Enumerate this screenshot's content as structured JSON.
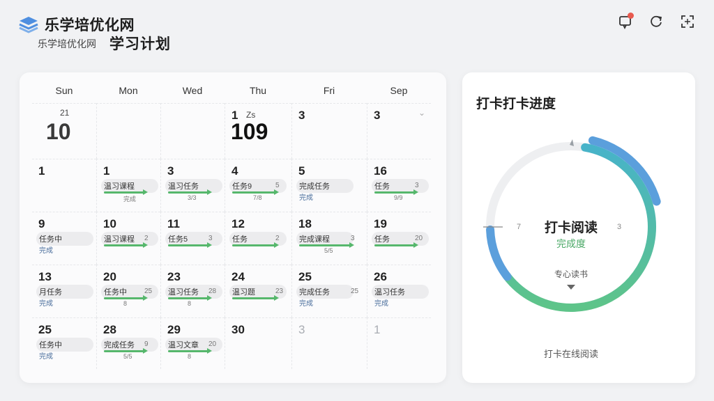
{
  "header": {
    "brand": "乐学培优化网",
    "brand_sub": "乐学培优化网",
    "page_title": "学习计划"
  },
  "colors": {
    "accent_blue": "#5b9fdc",
    "accent_teal": "#47b3c9",
    "accent_green": "#5ec489",
    "notif": "#e85a4f"
  },
  "top_icons": [
    "message-notification-icon",
    "refresh-icon",
    "expand-icon"
  ],
  "calendar": {
    "weekdays": [
      "Sun",
      "Mon",
      "Wed",
      "Thu",
      "Fri",
      "Sep"
    ],
    "row0": [
      {
        "small": "21",
        "big": "10"
      },
      {},
      {},
      {
        "num": "1",
        "small": "Zs",
        "big": "109"
      },
      {
        "num": "3"
      },
      {
        "num": "3"
      }
    ],
    "rows": [
      [
        {
          "num": "1"
        },
        {
          "num": "1",
          "task": "温习课程",
          "sub": "完成"
        },
        {
          "num": "3",
          "task": "温习任务",
          "sub": "3/3"
        },
        {
          "num": "4",
          "task": "任务9",
          "count": "5",
          "sub": "7/8"
        },
        {
          "num": "5",
          "task": "完成任务",
          "sub2": "完成"
        },
        {
          "num": "16",
          "task": "任务",
          "count": "3",
          "sub": "9/9"
        }
      ],
      [
        {
          "num": "9",
          "task": "任务中",
          "sub2": "完成"
        },
        {
          "num": "10",
          "task": "温习课程",
          "count": "2"
        },
        {
          "num": "11",
          "task": "任务5",
          "count": "3"
        },
        {
          "num": "12",
          "task": "任务",
          "count": "2"
        },
        {
          "num": "18",
          "task": "完成课程",
          "count": "3",
          "sub": "5/5"
        },
        {
          "num": "19",
          "task": "任务",
          "count": "20"
        }
      ],
      [
        {
          "num": "13",
          "task": "月任务",
          "sub2": "完成"
        },
        {
          "num": "20",
          "task": "任务中",
          "count": "25",
          "sub": "8"
        },
        {
          "num": "23",
          "task": "温习任务",
          "count": "28",
          "sub": "8"
        },
        {
          "num": "24",
          "task": "温习题",
          "count": "23"
        },
        {
          "num": "25",
          "task": "完成任务",
          "count": "25",
          "sub2": "完成"
        },
        {
          "num": "26",
          "task": "温习任务",
          "sub2": "完成"
        }
      ],
      [
        {
          "num": "25",
          "task": "任务中",
          "sub2": "完成"
        },
        {
          "num": "28",
          "task": "完成任务",
          "count": "9",
          "sub": "5/5"
        },
        {
          "num": "29",
          "task": "温习文章",
          "count": "20",
          "sub": "8"
        },
        {
          "num": "30"
        },
        {
          "num": "3",
          "muted": true
        },
        {
          "num": "1",
          "muted": true
        }
      ]
    ]
  },
  "progress": {
    "title": "打卡打卡进度",
    "center_title": "打卡阅读",
    "center_sub": "完成度",
    "left_label": "7",
    "right_label": "3",
    "hint": "专心读书",
    "footer": "打卡在线阅读",
    "outer_fraction": 0.62,
    "inner_fraction": 0.3
  }
}
